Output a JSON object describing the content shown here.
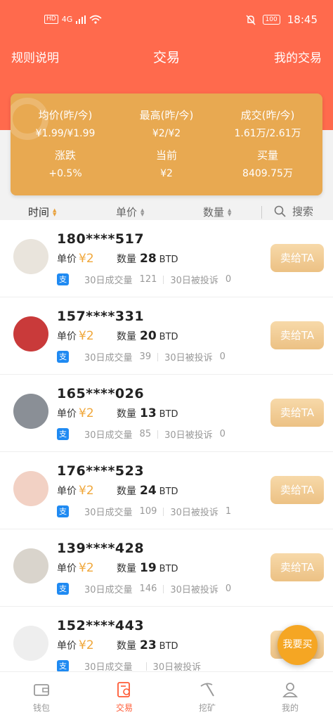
{
  "status": {
    "time": "18:45",
    "battery": "100",
    "hd": "HD",
    "net": "4G"
  },
  "nav": {
    "rules": "规则说明",
    "title": "交易",
    "my_trades": "我的交易"
  },
  "summary": {
    "avg_label": "均价(昨/今)",
    "avg_value": "¥1.99/¥1.99",
    "high_label": "最高(昨/今)",
    "high_value": "¥2/¥2",
    "volume_label": "成交(昨/今)",
    "volume_value": "1.61万/2.61万",
    "change_label": "涨跌",
    "change_value": "+0.5%",
    "current_label": "当前",
    "current_value": "¥2",
    "buy_label": "买量",
    "buy_value": "8409.75万"
  },
  "filters": {
    "time": "时间",
    "price": "单价",
    "qty": "数量",
    "search": "搜索"
  },
  "labels": {
    "price": "单价",
    "qty": "数量",
    "unit": "BTD",
    "deals": "30日成交量",
    "complaints": "30日被投诉",
    "sell": "卖给TA",
    "alipay": "支"
  },
  "rows": [
    {
      "name": "180****517",
      "price": "¥2",
      "qty": "28",
      "deals": "121",
      "complaints": "0"
    },
    {
      "name": "157****331",
      "price": "¥2",
      "qty": "20",
      "deals": "39",
      "complaints": "0"
    },
    {
      "name": "165****026",
      "price": "¥2",
      "qty": "13",
      "deals": "85",
      "complaints": "0"
    },
    {
      "name": "176****523",
      "price": "¥2",
      "qty": "24",
      "deals": "109",
      "complaints": "1"
    },
    {
      "name": "139****428",
      "price": "¥2",
      "qty": "19",
      "deals": "146",
      "complaints": "0"
    },
    {
      "name": "152****443",
      "price": "¥2",
      "qty": "23",
      "deals": "",
      "complaints": ""
    }
  ],
  "float_buy": "我要买",
  "tabs": [
    {
      "label": "钱包",
      "icon": "wallet-icon"
    },
    {
      "label": "交易",
      "icon": "trade-icon"
    },
    {
      "label": "挖矿",
      "icon": "pickaxe-icon"
    },
    {
      "label": "我的",
      "icon": "person-icon"
    }
  ],
  "colors": {
    "header": "#ff6a4d",
    "card": "#e8a951",
    "accent": "#f0a73a",
    "active_tab": "#ff5a35"
  }
}
